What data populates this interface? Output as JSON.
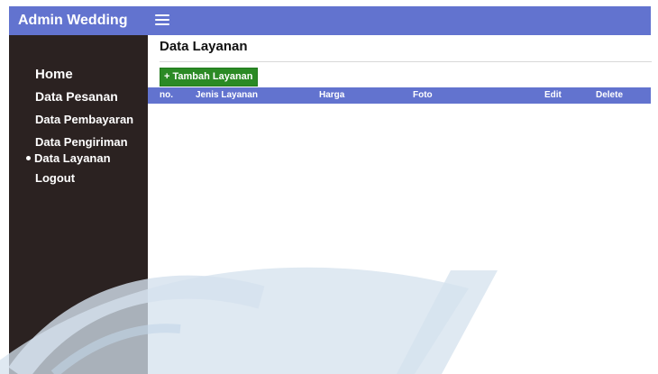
{
  "app": {
    "title": "Admin Wedding"
  },
  "sidebar": {
    "items": [
      {
        "label": "Home",
        "active": false
      },
      {
        "label": "Data Pesanan",
        "active": false
      },
      {
        "label": "Data Pembayaran",
        "active": false
      },
      {
        "label": "Data Pengiriman",
        "active": false
      },
      {
        "label": "Data Layanan",
        "active": true
      },
      {
        "label": "Logout",
        "active": false
      }
    ]
  },
  "main": {
    "page_title": "Data Layanan",
    "add_button_label": "+ Tambah Layanan",
    "table": {
      "columns": [
        "no.",
        "Jenis Layanan",
        "Harga",
        "Foto",
        "Edit",
        "Delete"
      ],
      "rows": []
    }
  },
  "icons": {
    "menu_toggle": "hamburger-menu-icon",
    "active_marker": "bullet-icon"
  },
  "colors": {
    "topbar": "#6273cf",
    "sidebar": "#2b2221",
    "table_header": "#6273cf",
    "add_button": "#2b8a25",
    "watermark": "#d4e1ee"
  }
}
